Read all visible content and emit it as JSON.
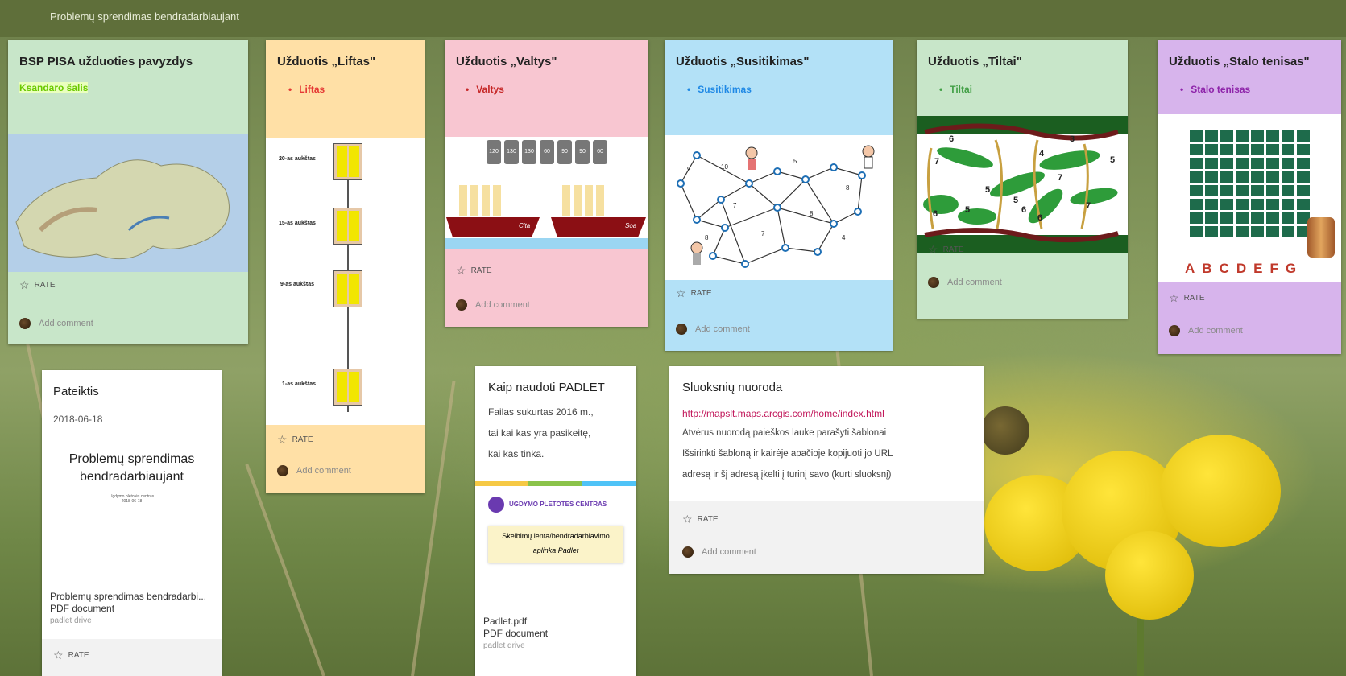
{
  "board": {
    "title": "Problemų sprendimas bendradarbiaujant"
  },
  "common": {
    "rate": "RATE",
    "add_comment": "Add comment"
  },
  "cards": {
    "pisa": {
      "title": "BSP PISA užduoties pavyzdys",
      "link": "Ksandaro šalis"
    },
    "liftas": {
      "title": "Užduotis „Liftas\"",
      "bullet": "Liftas",
      "floors": [
        "20-as aukštas",
        "15-as aukštas",
        "9-as aukštas",
        "1-as aukštas"
      ]
    },
    "valtys": {
      "title": "Užduotis „Valtys\"",
      "bullet": "Valtys",
      "barrels": [
        "120",
        "130",
        "130",
        "60",
        "90",
        "90",
        "60"
      ],
      "boat_labels": [
        "Cita",
        "Soa"
      ]
    },
    "susitikimas": {
      "title": "Užduotis „Susitikimas\"",
      "bullet": "Susitikimas"
    },
    "tiltai": {
      "title": "Užduotis „Tiltai\"",
      "bullet": "Tiltai",
      "numbers": [
        "6",
        "7",
        "5",
        "3",
        "5",
        "4",
        "7",
        "5",
        "6",
        "7",
        "5",
        "6",
        "6"
      ]
    },
    "stalo": {
      "title": "Užduotis „Stalo tenisas\"",
      "bullet": "Stalo tenisas",
      "letters": [
        "A",
        "B",
        "C",
        "D",
        "E",
        "F",
        "G"
      ]
    },
    "pateiktis": {
      "title": "Pateiktis",
      "date": "2018-06-18",
      "preview_title": "Problemų sprendimas bendradarbiaujant",
      "preview_sub1": "Ugdymo plėtotės centras",
      "preview_sub2": "2018-06-18",
      "file_name": "Problemų sprendimas bendradarbi...",
      "file_type": "PDF document",
      "file_src": "padlet drive"
    },
    "padlet": {
      "title": "Kaip naudoti PADLET",
      "text": [
        "Failas sukurtas 2016 m.,",
        "tai kai kas yra pasikeitę,",
        "kai kas tinka."
      ],
      "preview_org": "UGDYMO PLĖTOTĖS CENTRAS",
      "preview_box1": "Skelbimų lenta/bendradarbiavimo",
      "preview_box2": "aplinka Padlet",
      "file_name": "Padlet.pdf",
      "file_type": "PDF document",
      "file_src": "padlet drive"
    },
    "sluoksniu": {
      "title": "Sluoksnių nuoroda",
      "url": "http://mapslt.maps.arcgis.com/home/index.html",
      "text": [
        "Atvėrus nuorodą paieškos lauke parašyti šablonai",
        "Išsirinkti šabloną ir kairėje apačioje kopijuoti jo URL",
        "adresą ir šį adresą įkelti į turinį savo (kurti sluoksnį)"
      ]
    }
  },
  "colors": {
    "green": "#c8e6c9",
    "orange": "#ffe0a6",
    "pink": "#f8c6d1",
    "blue": "#b3e1f7",
    "purple": "#d7b4ec",
    "white": "#ffffff"
  }
}
